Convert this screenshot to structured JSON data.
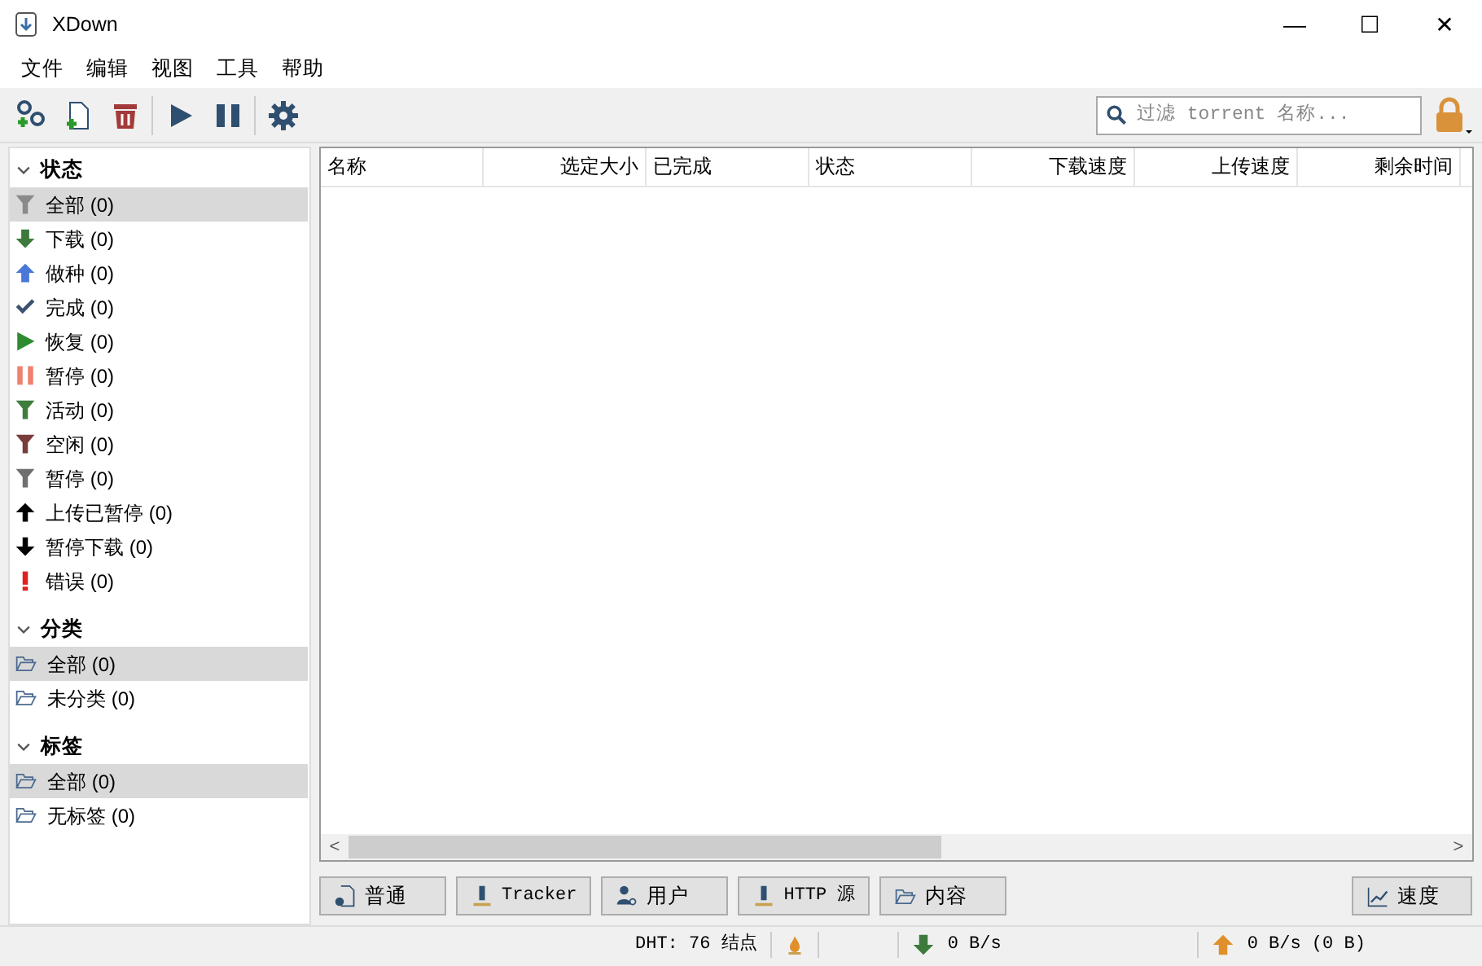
{
  "window": {
    "title": "XDown",
    "controls": [
      "—",
      "☐",
      "✕"
    ]
  },
  "menu": [
    "文件",
    "编辑",
    "视图",
    "工具",
    "帮助"
  ],
  "toolbar": [
    {
      "kind": "add-link"
    },
    {
      "kind": "add-file"
    },
    {
      "kind": "delete"
    },
    {
      "kind": "sep"
    },
    {
      "kind": "play"
    },
    {
      "kind": "pause"
    },
    {
      "kind": "sep"
    },
    {
      "kind": "settings"
    }
  ],
  "search": {
    "placeholder": "过滤 torrent 名称..."
  },
  "sidebar": [
    {
      "title": "状态",
      "expanded": true,
      "items": [
        {
          "label": "全部 (0)",
          "kind": "filter",
          "color": "#8a8a8a",
          "selected": true
        },
        {
          "label": "下载 (0)",
          "kind": "down",
          "selected": false
        },
        {
          "label": "做种 (0)",
          "kind": "up",
          "selected": false
        },
        {
          "label": "完成 (0)",
          "kind": "check",
          "selected": false
        },
        {
          "label": "恢复 (0)",
          "kind": "play",
          "selected": false
        },
        {
          "label": "暂停 (0)",
          "kind": "pause",
          "selected": false
        },
        {
          "label": "活动 (0)",
          "kind": "filter",
          "color": "#3f7d3f",
          "selected": false
        },
        {
          "label": "空闲 (0)",
          "kind": "filter",
          "color": "#7a3b3b",
          "selected": false
        },
        {
          "label": "暂停 (0)",
          "kind": "filter",
          "color": "#6f6f6f",
          "selected": false
        },
        {
          "label": "上传已暂停 (0)",
          "kind": "upbold",
          "selected": false
        },
        {
          "label": "暂停下载 (0)",
          "kind": "downbold",
          "selected": false
        },
        {
          "label": "错误 (0)",
          "kind": "error",
          "selected": false
        }
      ]
    },
    {
      "title": "分类",
      "expanded": true,
      "items": [
        {
          "label": "全部 (0)",
          "kind": "folder",
          "selected": true
        },
        {
          "label": "未分类 (0)",
          "kind": "folder",
          "selected": false
        }
      ]
    },
    {
      "title": "标签",
      "expanded": true,
      "items": [
        {
          "label": "全部 (0)",
          "kind": "folder",
          "selected": true
        },
        {
          "label": "无标签 (0)",
          "kind": "folder",
          "selected": false
        }
      ]
    }
  ],
  "table": {
    "columns": [
      {
        "label": "名称"
      },
      {
        "label": "选定大小"
      },
      {
        "label": "已完成"
      },
      {
        "label": "状态"
      },
      {
        "label": "下载速度"
      },
      {
        "label": "上传速度"
      },
      {
        "label": "剩余时间"
      }
    ]
  },
  "scrollbar": {
    "left": "<",
    "right": ">"
  },
  "tabs": [
    {
      "label": "普通",
      "kind": "general"
    },
    {
      "label": "Tracker",
      "kind": "tracker"
    },
    {
      "label": "用户",
      "kind": "user"
    },
    {
      "label": "HTTP 源",
      "kind": "tracker"
    },
    {
      "label": "内容",
      "kind": "folder"
    }
  ],
  "speed_button": {
    "label": "速度"
  },
  "status_bar": {
    "dht": "DHT: 76 结点",
    "download": "0 B/s",
    "upload": "0 B/s (0 B)"
  }
}
